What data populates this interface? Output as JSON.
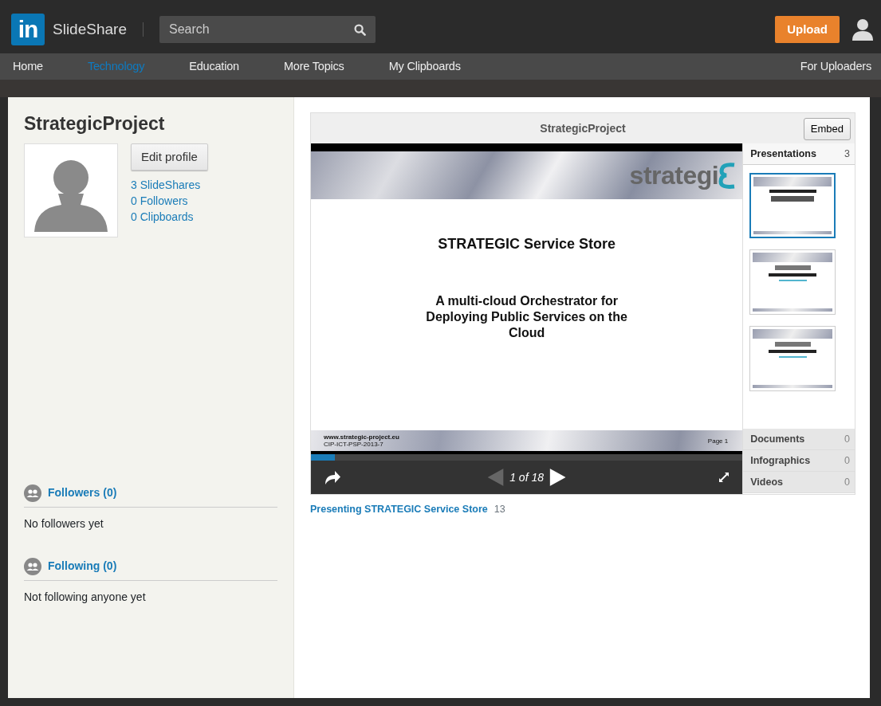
{
  "header": {
    "logo_text": "in",
    "brand": "SlideShare",
    "search": {
      "placeholder": "Search"
    },
    "upload_button": "Upload"
  },
  "nav": {
    "items": [
      {
        "label": "Home",
        "selected": false
      },
      {
        "label": "Technology",
        "selected": true
      },
      {
        "label": "Education",
        "selected": false
      },
      {
        "label": "More Topics",
        "selected": false
      },
      {
        "label": "My Clipboards",
        "selected": false
      }
    ],
    "right_link": "For Uploaders"
  },
  "profile": {
    "name": "StrategicProject",
    "edit_button": "Edit profile",
    "stats": [
      "3 SlideShares",
      "0 Followers",
      "0 Clipboards"
    ],
    "sections": [
      {
        "title": "Followers (0)",
        "empty_text": "No followers yet"
      },
      {
        "title": "Following (0)",
        "empty_text": "Not following anyone yet"
      }
    ]
  },
  "player": {
    "title": "StrategicProject",
    "embed_button": "Embed",
    "slide": {
      "logo_text": "strategi",
      "title": "STRATEGIC Service Store",
      "subtitle": "A multi-cloud Orchestrator for Deploying Public Services on the Cloud",
      "footer_url": "www.strategic-project.eu",
      "footer_code": "CIP-ICT-PSP-2013-7",
      "page": "Page 1"
    },
    "progress": {
      "level": 0.056
    },
    "counter": "1 of 18",
    "side": [
      {
        "label": "Presentations",
        "count": "3",
        "expanded": true
      },
      {
        "label": "Documents",
        "count": "0",
        "expanded": false
      },
      {
        "label": "Infographics",
        "count": "0",
        "expanded": false
      },
      {
        "label": "Videos",
        "count": "0",
        "expanded": false
      }
    ],
    "thumbnails": [
      {
        "selected": true,
        "kind": "title"
      },
      {
        "selected": false,
        "kind": "cover"
      },
      {
        "selected": false,
        "kind": "cover"
      }
    ]
  },
  "caption": {
    "link": "Presenting STRATEGIC Service Store",
    "count": "13"
  }
}
